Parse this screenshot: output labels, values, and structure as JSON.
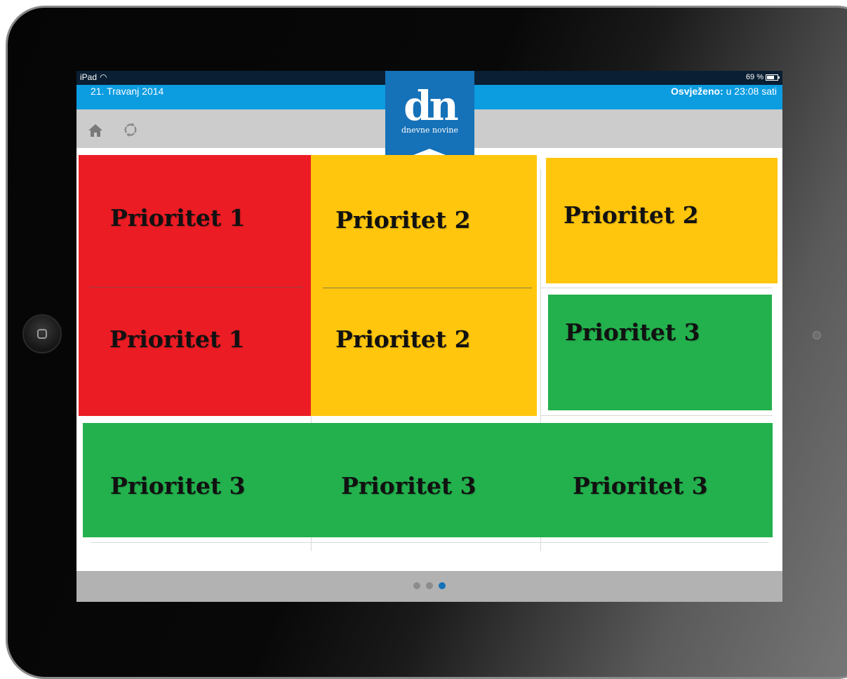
{
  "status_bar": {
    "device": "iPad",
    "time": "23:08",
    "battery": "69 %"
  },
  "header": {
    "date": "21. Travanj 2014",
    "refreshed_label": "Osvježeno:",
    "refreshed_value": "u 23:08 sati"
  },
  "logo": {
    "mark": "dn",
    "name": "dnevne novine"
  },
  "toolbar": {
    "icons": [
      "home-icon",
      "refresh-icon"
    ]
  },
  "tiles": [
    {
      "label": "Prioritet 1",
      "color": "#ec1c24"
    },
    {
      "label": "Prioritet 1",
      "color": "#ec1c24"
    },
    {
      "label": "Prioritet 2",
      "color": "#ffc60d"
    },
    {
      "label": "Prioritet 2",
      "color": "#ffc60d"
    },
    {
      "label": "Prioritet 2",
      "color": "#ffc60d"
    },
    {
      "label": "Prioritet 3",
      "color": "#23b14d"
    },
    {
      "label": "Prioritet 3",
      "color": "#23b14d"
    },
    {
      "label": "Prioritet 3",
      "color": "#23b14d"
    },
    {
      "label": "Prioritet 3",
      "color": "#23b14d"
    }
  ],
  "pager": {
    "pages": 3,
    "active": 3
  },
  "colors": {
    "header_blue": "#0c9ce0",
    "logo_blue": "#1571b8",
    "toolbar_gray": "#cccccc",
    "footer_gray": "#b2b2b2"
  }
}
